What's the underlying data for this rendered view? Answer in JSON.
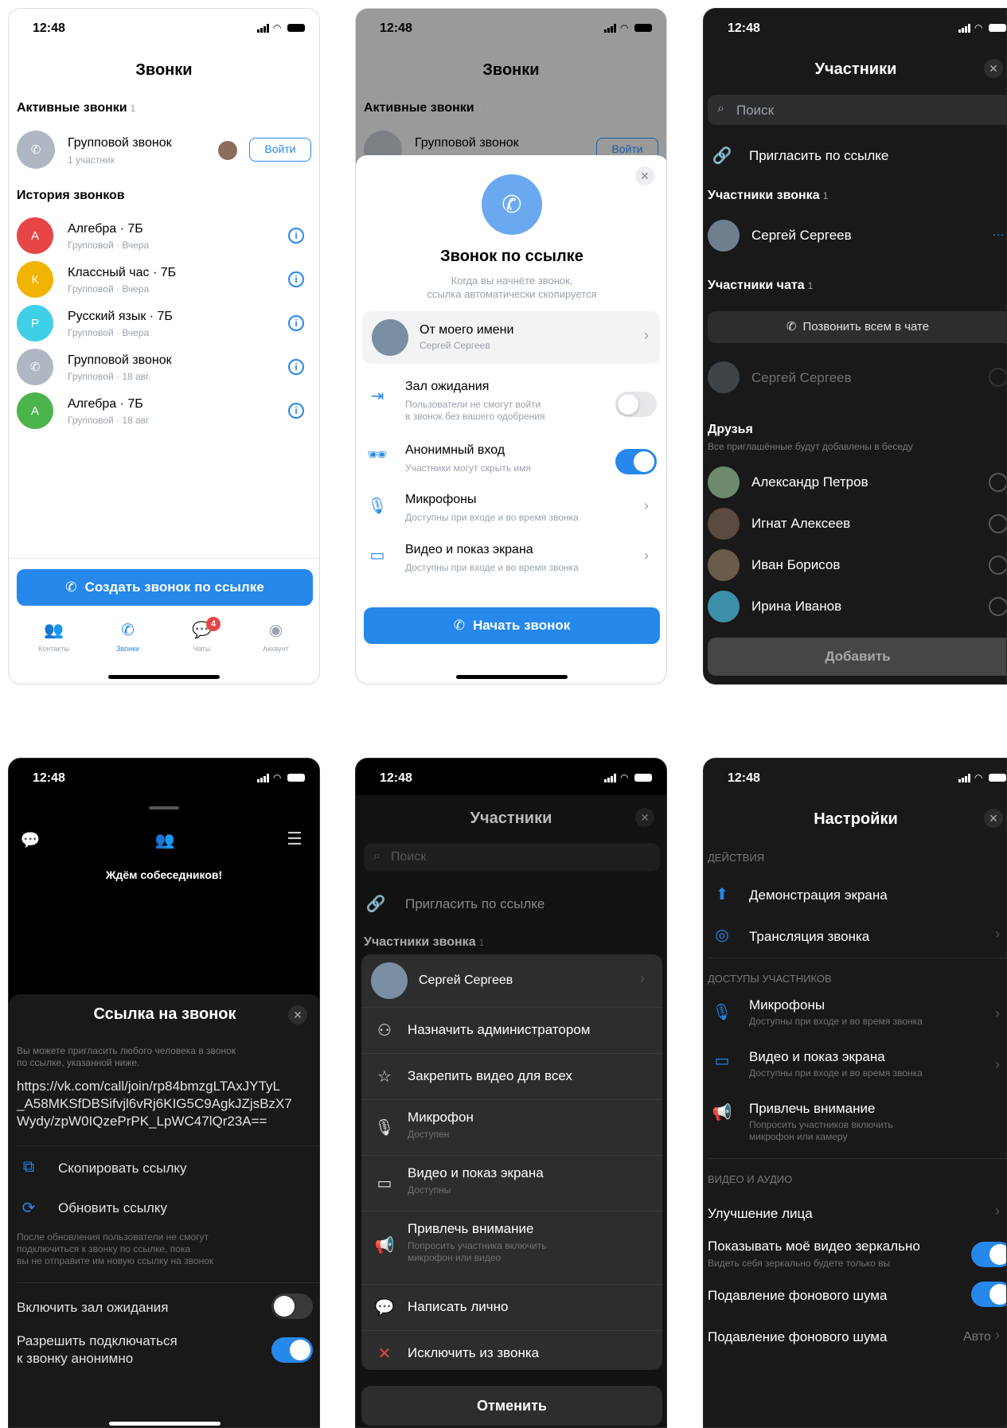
{
  "status_time": "12:48",
  "p1": {
    "title": "Звонки",
    "active_header": "Активные звонки",
    "active_count": "1",
    "active_call": {
      "name": "Групповой звонок",
      "sub": "1 участник",
      "join": "Войти"
    },
    "history_header": "История звонков",
    "history": [
      {
        "letter": "А",
        "color": "#e64646",
        "name": "Алгебра · 7Б",
        "sub": "Групповой · Вчера"
      },
      {
        "letter": "К",
        "color": "#f0b400",
        "name": "Классный час · 7Б",
        "sub": "Групповой · Вчера"
      },
      {
        "letter": "Р",
        "color": "#3fcfe6",
        "name": "Русский язык · 7Б",
        "sub": "Групповой · Вчера"
      },
      {
        "letter": "",
        "color": "#aeb7c2",
        "name": "Групповой звонок",
        "sub": "Групповой · 18 авг."
      },
      {
        "letter": "А",
        "color": "#4bb34b",
        "name": "Алгебра · 7Б",
        "sub": "Групповой · 18 авг"
      }
    ],
    "create_button": "Создать звонок по ссылке",
    "tabs": [
      {
        "label": "Контакты",
        "icon": "contacts-icon"
      },
      {
        "label": "Звонки",
        "icon": "calls-icon"
      },
      {
        "label": "Чаты",
        "icon": "chats-icon",
        "badge": "4"
      },
      {
        "label": "Аккаунт",
        "icon": "account-icon"
      }
    ]
  },
  "p2": {
    "title": "Звонки",
    "active_header": "Активные звонки",
    "active_count": "1",
    "active_name": "Групповой звонок",
    "join": "Войти",
    "modal_title": "Звонок по ссылке",
    "modal_desc1": "Когда вы начнёте звонок,",
    "modal_desc2": "ссылка автоматически скопируется",
    "from_label": "От моего имени",
    "from_name": "Сергей Сергеев",
    "waiting_title": "Зал ожидания",
    "waiting_sub1": "Пользователи не смогут войти",
    "waiting_sub2": "в звонок без вашего одобрения",
    "anon_title": "Анонимный вход",
    "anon_sub": "Участники могут скрыть имя",
    "mic_title": "Микрофоны",
    "mic_sub": "Доступны при входе и во время звонка",
    "video_title": "Видео и показ экрана",
    "video_sub": "Доступны при входе и во время звонка",
    "start_button": "Начать звонок"
  },
  "p3": {
    "title": "Участники",
    "search_placeholder": "Поиск",
    "invite": "Пригласить по ссылке",
    "call_members_header": "Участники звонка",
    "call_members_count": "1",
    "member": "Сергей Сергеев",
    "chat_members_header": "Участники чата",
    "chat_members_count": "1",
    "call_all": "Позвонить всем в чате",
    "chat_member": "Сергей Сергеев",
    "friends_header": "Друзья",
    "friends_sub": "Все приглашённые будут добавлены в беседу",
    "friends": [
      "Александр Петров",
      "Игнат Алексеев",
      "Иван Борисов",
      "Ирина Иванов"
    ],
    "add_button": "Добавить"
  },
  "p4": {
    "waiting": "Ждём собеседников!",
    "sheet_title": "Ссылка на звонок",
    "desc1": "Вы можете пригласить любого человека в звонок",
    "desc2": "по ссылке, указанной ниже.",
    "link1": "https://vk.com/call/join/rp84bmzgLTAxJYTyL",
    "link2": "_A58MKSfDBSifvjl6vRj6KIG5C9AgkJZjsBzX7",
    "link3": "Wydy/zpW0IQzePrPK_LpWC47lQr23A==",
    "copy": "Скопировать ссылку",
    "refresh": "Обновить ссылку",
    "note1": "После обновления пользователи не смогут",
    "note2": "подключиться к звонку по ссылке, пока",
    "note3": "вы не отправите им новую ссылку на звонок",
    "waiting_room": "Включить зал ожидания",
    "anon1": "Разрешить подключаться",
    "anon2": "к звонку анонимно"
  },
  "p5": {
    "title": "Участники",
    "search_placeholder": "Поиск",
    "invite": "Пригласить по ссылке",
    "call_members_header": "Участники звонка",
    "call_members_count": "1",
    "member": "Сергей Сергеев",
    "actions": [
      {
        "label": "Назначить администратором",
        "sub": "",
        "icon": "admin-icon"
      },
      {
        "label": "Закрепить видео для всех",
        "sub": "",
        "icon": "pin-icon"
      },
      {
        "label": "Микрофон",
        "sub": "Доступен",
        "icon": "microphone-icon"
      },
      {
        "label": "Видео и показ экрана",
        "sub": "Доступны",
        "icon": "video-icon"
      },
      {
        "label": "Привлечь внимание",
        "sub": "Попросить участника включить",
        "sub2": "микрофон или видео",
        "icon": "megaphone-icon"
      },
      {
        "label": "Написать лично",
        "sub": "",
        "icon": "message-icon"
      },
      {
        "label": "Исключить из звонка",
        "sub": "",
        "icon": "cross-icon"
      }
    ],
    "cancel": "Отменить"
  },
  "p6": {
    "title": "Настройки",
    "actions_header": "ДЕЙСТВИЯ",
    "screen_demo": "Демонстрация экрана",
    "broadcast": "Трансляция звонка",
    "access_header": "ДОСТУПЫ УЧАСТНИКОВ",
    "mic_title": "Микрофоны",
    "mic_sub": "Доступны при входе и во время звонка",
    "video_title": "Видео и показ экрана",
    "video_sub": "Доступны при входе и во время звонка",
    "attention_title": "Привлечь внимание",
    "attention_sub1": "Попросить участников включить",
    "attention_sub2": "микрофон или камеру",
    "av_header": "ВИДЕО И АУДИО",
    "face": "Улучшение лица",
    "mirror": "Показывать моё видео зеркально",
    "mirror_sub": "Видеть себя зеркально будете только вы",
    "noise1": "Подавление фонового шума",
    "noise2": "Подавление фонового шума",
    "noise2_value": "Авто"
  }
}
